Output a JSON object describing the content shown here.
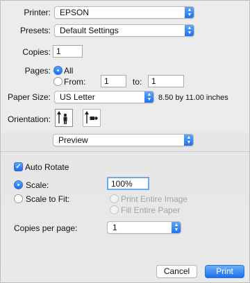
{
  "printer": {
    "label": "Printer:",
    "value": "EPSON"
  },
  "presets": {
    "label": "Presets:",
    "value": "Default Settings"
  },
  "copies": {
    "label": "Copies:",
    "value": "1"
  },
  "pages": {
    "label": "Pages:",
    "all_label": "All",
    "from_label": "From:",
    "from_value": "1",
    "to_label": "to:",
    "to_value": "1",
    "selected": "All"
  },
  "paper_size": {
    "label": "Paper Size:",
    "value": "US Letter",
    "dimensions": "8.50 by 11.00 inches"
  },
  "orientation": {
    "label": "Orientation:",
    "options": [
      "portrait",
      "landscape"
    ],
    "selected": "portrait"
  },
  "section_popup": {
    "value": "Preview"
  },
  "auto_rotate": {
    "label": "Auto Rotate",
    "checked": true
  },
  "scale": {
    "label": "Scale:",
    "value": "100%",
    "selected": true
  },
  "scale_to_fit": {
    "label": "Scale to Fit:",
    "print_entire_image": "Print Entire Image",
    "fill_entire_paper": "Fill Entire Paper"
  },
  "copies_per_page": {
    "label": "Copies per page:",
    "value": "1"
  },
  "buttons": {
    "cancel": "Cancel",
    "print": "Print"
  },
  "colors": {
    "accent": "#1a6ff0"
  }
}
